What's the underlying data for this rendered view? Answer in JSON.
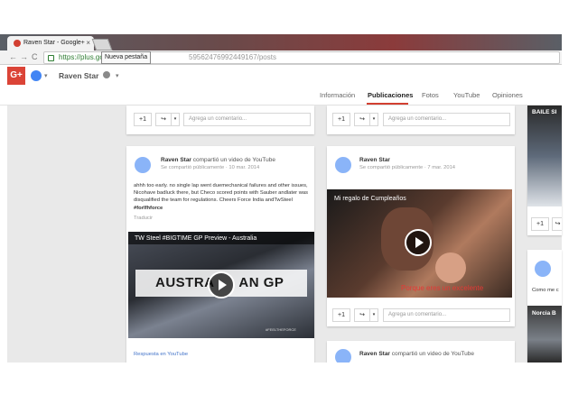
{
  "browser": {
    "tab_title": "Raven Star - Google+",
    "tab_close": "×",
    "tooltip": "Nueva pestaña",
    "back": "←",
    "forward": "→",
    "reload": "C",
    "url_visible": "https://plus.go",
    "url_rest": "595624769924491​67/posts"
  },
  "header": {
    "logo": "G+",
    "page_name": "Raven Star"
  },
  "tabs": [
    {
      "label": "Información"
    },
    {
      "label": "Publicaciones"
    },
    {
      "label": "Fotos"
    },
    {
      "label": "YouTube"
    },
    {
      "label": "Opiniones"
    }
  ],
  "actions": {
    "plus_one": "+1",
    "share": "↪",
    "comment_placeholder": "Agrega un comentario..."
  },
  "posts": [
    {
      "author": "Raven Star",
      "action": "compartió un video de YouTube",
      "meta": "Se compartió públicamente  ·  10 mar. 2014",
      "text": "ahhh too early.  no single lap went  duemechanical failures and other issues, Nicohave badluck there, but Checo scored points with Sauber andlater was disqualified the team for regulations. Cheers Force India andTwSteel",
      "hashtag": "#forlfhforce",
      "translate": "Traducir",
      "video_title": "TW Steel #BIGTIME GP Preview - Australia",
      "video_overlay": "AUSTRA      AN GP",
      "video_brand": "#FEELTHEFORCE",
      "link": "Respuesta en YouTube"
    },
    {
      "author": "Raven Star",
      "meta": "Se compartió públicamente  ·  7 mar. 2014",
      "video_title": "Mi regalo de Cumpleaños",
      "video_caption": "Porque eres un excelente"
    },
    {
      "author": "Raven Star",
      "action": "compartió un video de YouTube"
    }
  ],
  "right_column": {
    "video_title": "BAILE SI",
    "card_text": "Como me c",
    "video2_title": "Norcia B"
  }
}
